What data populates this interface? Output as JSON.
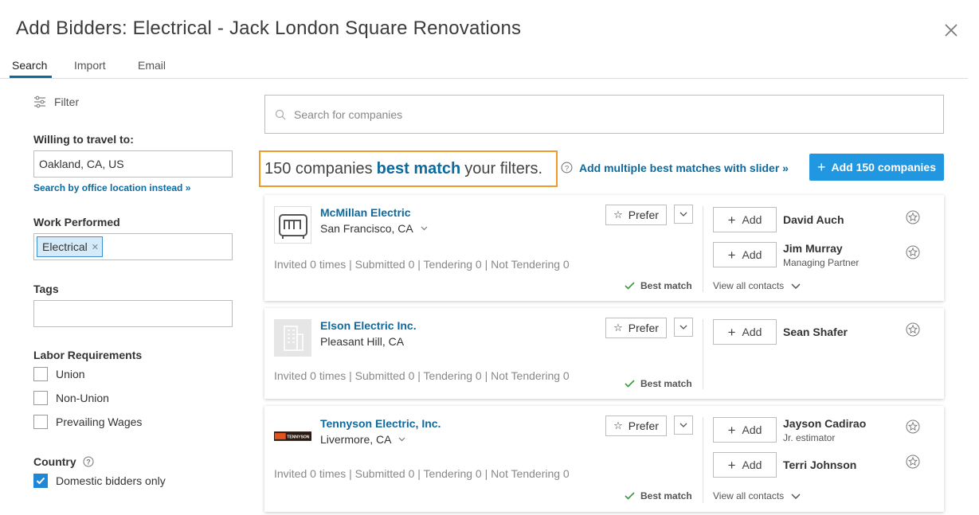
{
  "title": "Add Bidders: Electrical - Jack London Square Renovations",
  "tabs": [
    {
      "label": "Search",
      "active": true
    },
    {
      "label": "Import",
      "active": false
    },
    {
      "label": "Email",
      "active": false
    }
  ],
  "sidebar": {
    "filter_label": "Filter",
    "travel_label": "Willing to travel to:",
    "travel_value": "Oakland, CA, US",
    "office_link": "Search by office location instead »",
    "work_label": "Work Performed",
    "work_chip": "Electrical",
    "tags_label": "Tags",
    "labor_label": "Labor Requirements",
    "labor_options": [
      {
        "label": "Union",
        "checked": false
      },
      {
        "label": "Non-Union",
        "checked": false
      },
      {
        "label": "Prevailing Wages",
        "checked": false
      }
    ],
    "country_label": "Country",
    "domestic_label": "Domestic bidders only",
    "domestic_checked": true
  },
  "search": {
    "placeholder": "Search for companies"
  },
  "results": {
    "count_prefix": "150 companies",
    "count_highlight": "best match",
    "count_suffix": "your filters.",
    "slider_link": "Add multiple best matches with slider »",
    "add_all_label": "Add 150 companies"
  },
  "companies": [
    {
      "name": "McMillan Electric",
      "city": "San Francisco, CA",
      "prefer_label": "Prefer",
      "stats": "Invited 0 times | Submitted 0 | Tendering 0 | Not Tendering 0",
      "match_label": "Best match",
      "contacts": [
        {
          "add_label": "Add",
          "name": "David Auch",
          "role": ""
        },
        {
          "add_label": "Add",
          "name": "Jim Murray",
          "role": "Managing Partner"
        }
      ],
      "view_all": "View all contacts"
    },
    {
      "name": "Elson Electric Inc.",
      "city": "Pleasant Hill, CA",
      "prefer_label": "Prefer",
      "stats": "Invited 0 times | Submitted 0 | Tendering 0 | Not Tendering 0",
      "match_label": "Best match",
      "contacts": [
        {
          "add_label": "Add",
          "name": "Sean Shafer",
          "role": ""
        }
      ]
    },
    {
      "name": "Tennyson Electric, Inc.",
      "city": "Livermore, CA",
      "prefer_label": "Prefer",
      "logo_text": "TENNYSON",
      "stats": "Invited 0 times | Submitted 0 | Tendering 0 | Not Tendering 0",
      "match_label": "Best match",
      "contacts": [
        {
          "add_label": "Add",
          "name": "Jayson Cadirao",
          "role": "Jr. estimator"
        },
        {
          "add_label": "Add",
          "name": "Terri Johnson",
          "role": ""
        }
      ],
      "view_all": "View all contacts"
    }
  ],
  "colors": {
    "accent": "#0d6a9e",
    "button": "#2097e0",
    "highlight_border": "#f09a2a",
    "chip_bg": "#d5ebf9"
  }
}
